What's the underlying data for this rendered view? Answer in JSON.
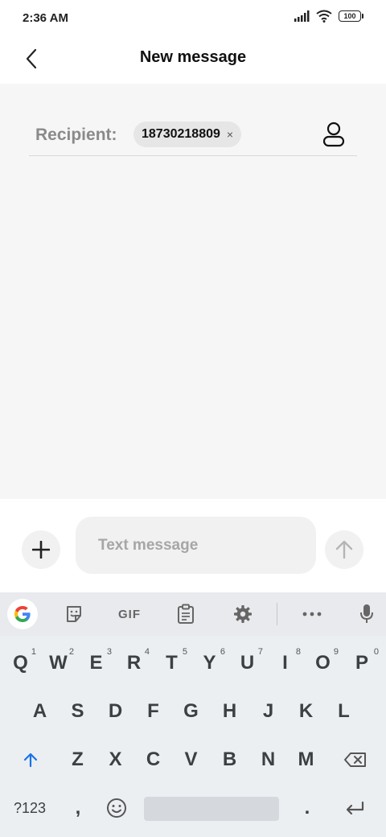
{
  "status_bar": {
    "time": "2:36 AM",
    "battery": "100"
  },
  "header": {
    "title": "New message"
  },
  "recipient": {
    "label": "Recipient:",
    "chip_value": "18730218809",
    "chip_remove": "×"
  },
  "compose": {
    "placeholder": "Text message"
  },
  "keyboard": {
    "toolbar": {
      "gif_label": "GIF"
    },
    "row1": [
      {
        "letter": "Q",
        "hint": "1"
      },
      {
        "letter": "W",
        "hint": "2"
      },
      {
        "letter": "E",
        "hint": "3"
      },
      {
        "letter": "R",
        "hint": "4"
      },
      {
        "letter": "T",
        "hint": "5"
      },
      {
        "letter": "Y",
        "hint": "6"
      },
      {
        "letter": "U",
        "hint": "7"
      },
      {
        "letter": "I",
        "hint": "8"
      },
      {
        "letter": "O",
        "hint": "9"
      },
      {
        "letter": "P",
        "hint": "0"
      }
    ],
    "row2": [
      "A",
      "S",
      "D",
      "F",
      "G",
      "H",
      "J",
      "K",
      "L"
    ],
    "row3": [
      "Z",
      "X",
      "C",
      "V",
      "B",
      "N",
      "M"
    ],
    "bottom": {
      "symbols": "?123",
      "comma": ",",
      "period": "."
    }
  },
  "colors": {
    "shift_blue": "#1a73e8",
    "content_bg": "#f6f6f6",
    "keyboard_bg": "#eceff1"
  },
  "icons": {
    "back": "chevron-left-icon",
    "contact": "person-icon",
    "add": "plus-icon",
    "send": "arrow-up-icon",
    "google": "google-g-icon",
    "sticker": "sticker-icon",
    "clipboard": "clipboard-icon",
    "settings": "gear-icon",
    "more": "more-horizontal-icon",
    "mic": "microphone-icon",
    "shift": "shift-arrow-icon",
    "backspace": "backspace-icon",
    "emoji": "emoji-icon",
    "enter": "enter-icon"
  }
}
